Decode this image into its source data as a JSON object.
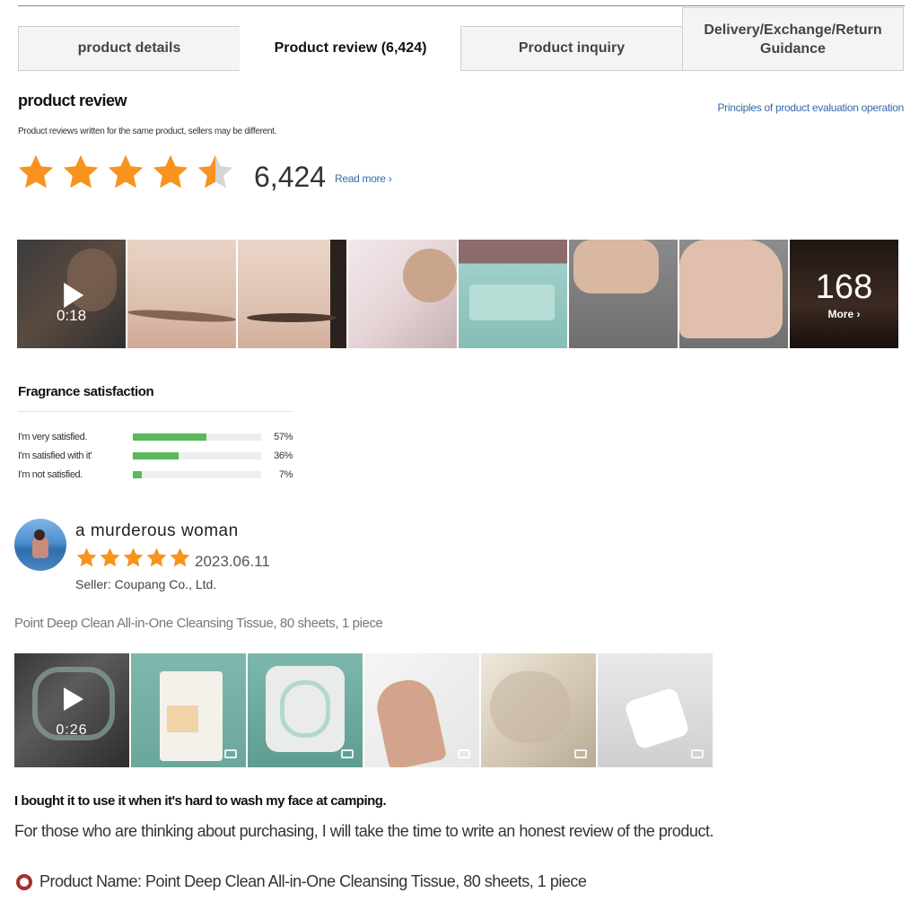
{
  "tabs": [
    {
      "label": "product details"
    },
    {
      "label": "Product review (6,424)"
    },
    {
      "label": "Product inquiry"
    },
    {
      "label": "Delivery/Exchange/Return Guidance"
    }
  ],
  "review_section": {
    "title": "product review",
    "principles_link": "Principles of product evaluation operation",
    "subtitle": "Product reviews written for the same product, sellers may be different.",
    "rating": 4.5,
    "review_count": "6,424",
    "read_more": "Read more",
    "media": {
      "video_time": "0:18",
      "more_count": "168",
      "more_label": "More"
    }
  },
  "fragrance": {
    "title": "Fragrance satisfaction",
    "rows": [
      {
        "label": "I'm very satisfied.",
        "percent": "57%",
        "value": 0.57
      },
      {
        "label": "I'm satisfied with it'",
        "percent": "36%",
        "value": 0.36
      },
      {
        "label": "I'm not satisfied.",
        "percent": "7%",
        "value": 0.07
      }
    ],
    "bar_color": "#5cb85c"
  },
  "review": {
    "username": "a murderous woman",
    "rating": 5,
    "date": "2023.06.11",
    "seller": "Seller: Coupang Co., Ltd.",
    "product_option": "Point Deep Clean All-in-One Cleansing Tissue, 80 sheets, 1 piece",
    "video_time": "0:26",
    "headline": "I bought it to use it when it's hard to wash my face at camping.",
    "body": "For those who are thinking about purchasing, I will take the time to write an honest review of the product.",
    "product_name_line": "Product Name: Point Deep Clean All-in-One Cleansing Tissue, 80 sheets, 1 piece"
  },
  "colors": {
    "star": "#f7931e",
    "star_empty": "#d6d6d6",
    "link": "#346aa8",
    "accent_ring": "#a8312a"
  }
}
